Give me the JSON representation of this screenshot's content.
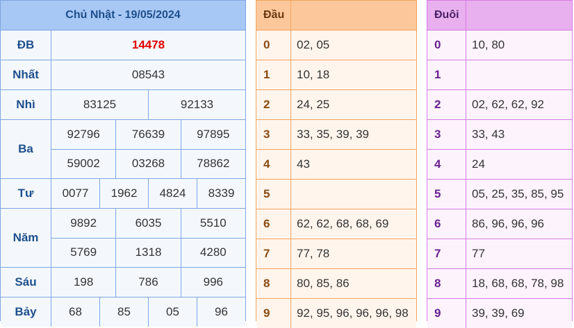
{
  "results": {
    "header": "Chủ Nhật - 19/05/2024",
    "prizes": [
      {
        "label": "ĐB",
        "lines": [
          [
            "14478"
          ]
        ]
      },
      {
        "label": "Nhất",
        "lines": [
          [
            "08543"
          ]
        ]
      },
      {
        "label": "Nhì",
        "lines": [
          [
            "83125",
            "92133"
          ]
        ]
      },
      {
        "label": "Ba",
        "lines": [
          [
            "92796",
            "76639",
            "97895"
          ],
          [
            "59002",
            "03268",
            "78862"
          ]
        ]
      },
      {
        "label": "Tư",
        "lines": [
          [
            "0077",
            "1962",
            "4824",
            "8339"
          ]
        ]
      },
      {
        "label": "Năm",
        "lines": [
          [
            "9892",
            "6035",
            "5510"
          ],
          [
            "5769",
            "1318",
            "4280"
          ]
        ]
      },
      {
        "label": "Sáu",
        "lines": [
          [
            "198",
            "786",
            "996"
          ]
        ]
      },
      {
        "label": "Bảy",
        "lines": [
          [
            "68",
            "85",
            "05",
            "96"
          ]
        ]
      }
    ]
  },
  "dau": {
    "header": "Đầu",
    "rows": [
      {
        "k": "0",
        "v": "02, 05"
      },
      {
        "k": "1",
        "v": "10, 18"
      },
      {
        "k": "2",
        "v": "24, 25"
      },
      {
        "k": "3",
        "v": "33, 35, 39, 39"
      },
      {
        "k": "4",
        "v": "43"
      },
      {
        "k": "5",
        "v": ""
      },
      {
        "k": "6",
        "v": "62, 62, 68, 68, 69"
      },
      {
        "k": "7",
        "v": "77, 78"
      },
      {
        "k": "8",
        "v": "80, 85, 86"
      },
      {
        "k": "9",
        "v": "92, 95, 96, 96, 96, 98"
      }
    ]
  },
  "duoi": {
    "header": "Đuôi",
    "rows": [
      {
        "k": "0",
        "v": "10, 80"
      },
      {
        "k": "1",
        "v": ""
      },
      {
        "k": "2",
        "v": "02, 62, 62, 92"
      },
      {
        "k": "3",
        "v": "33, 43"
      },
      {
        "k": "4",
        "v": "24"
      },
      {
        "k": "5",
        "v": "05, 25, 35, 85, 95"
      },
      {
        "k": "6",
        "v": "86, 96, 96, 96"
      },
      {
        "k": "7",
        "v": "77"
      },
      {
        "k": "8",
        "v": "18, 68, 68, 78, 98"
      },
      {
        "k": "9",
        "v": "39, 39, 69"
      }
    ]
  },
  "colors": {
    "special_prize": "#e00000",
    "results_header_bg": "#a7c7f5",
    "dau_header_bg": "#fcc89b",
    "duoi_header_bg": "#e9b0ef"
  }
}
